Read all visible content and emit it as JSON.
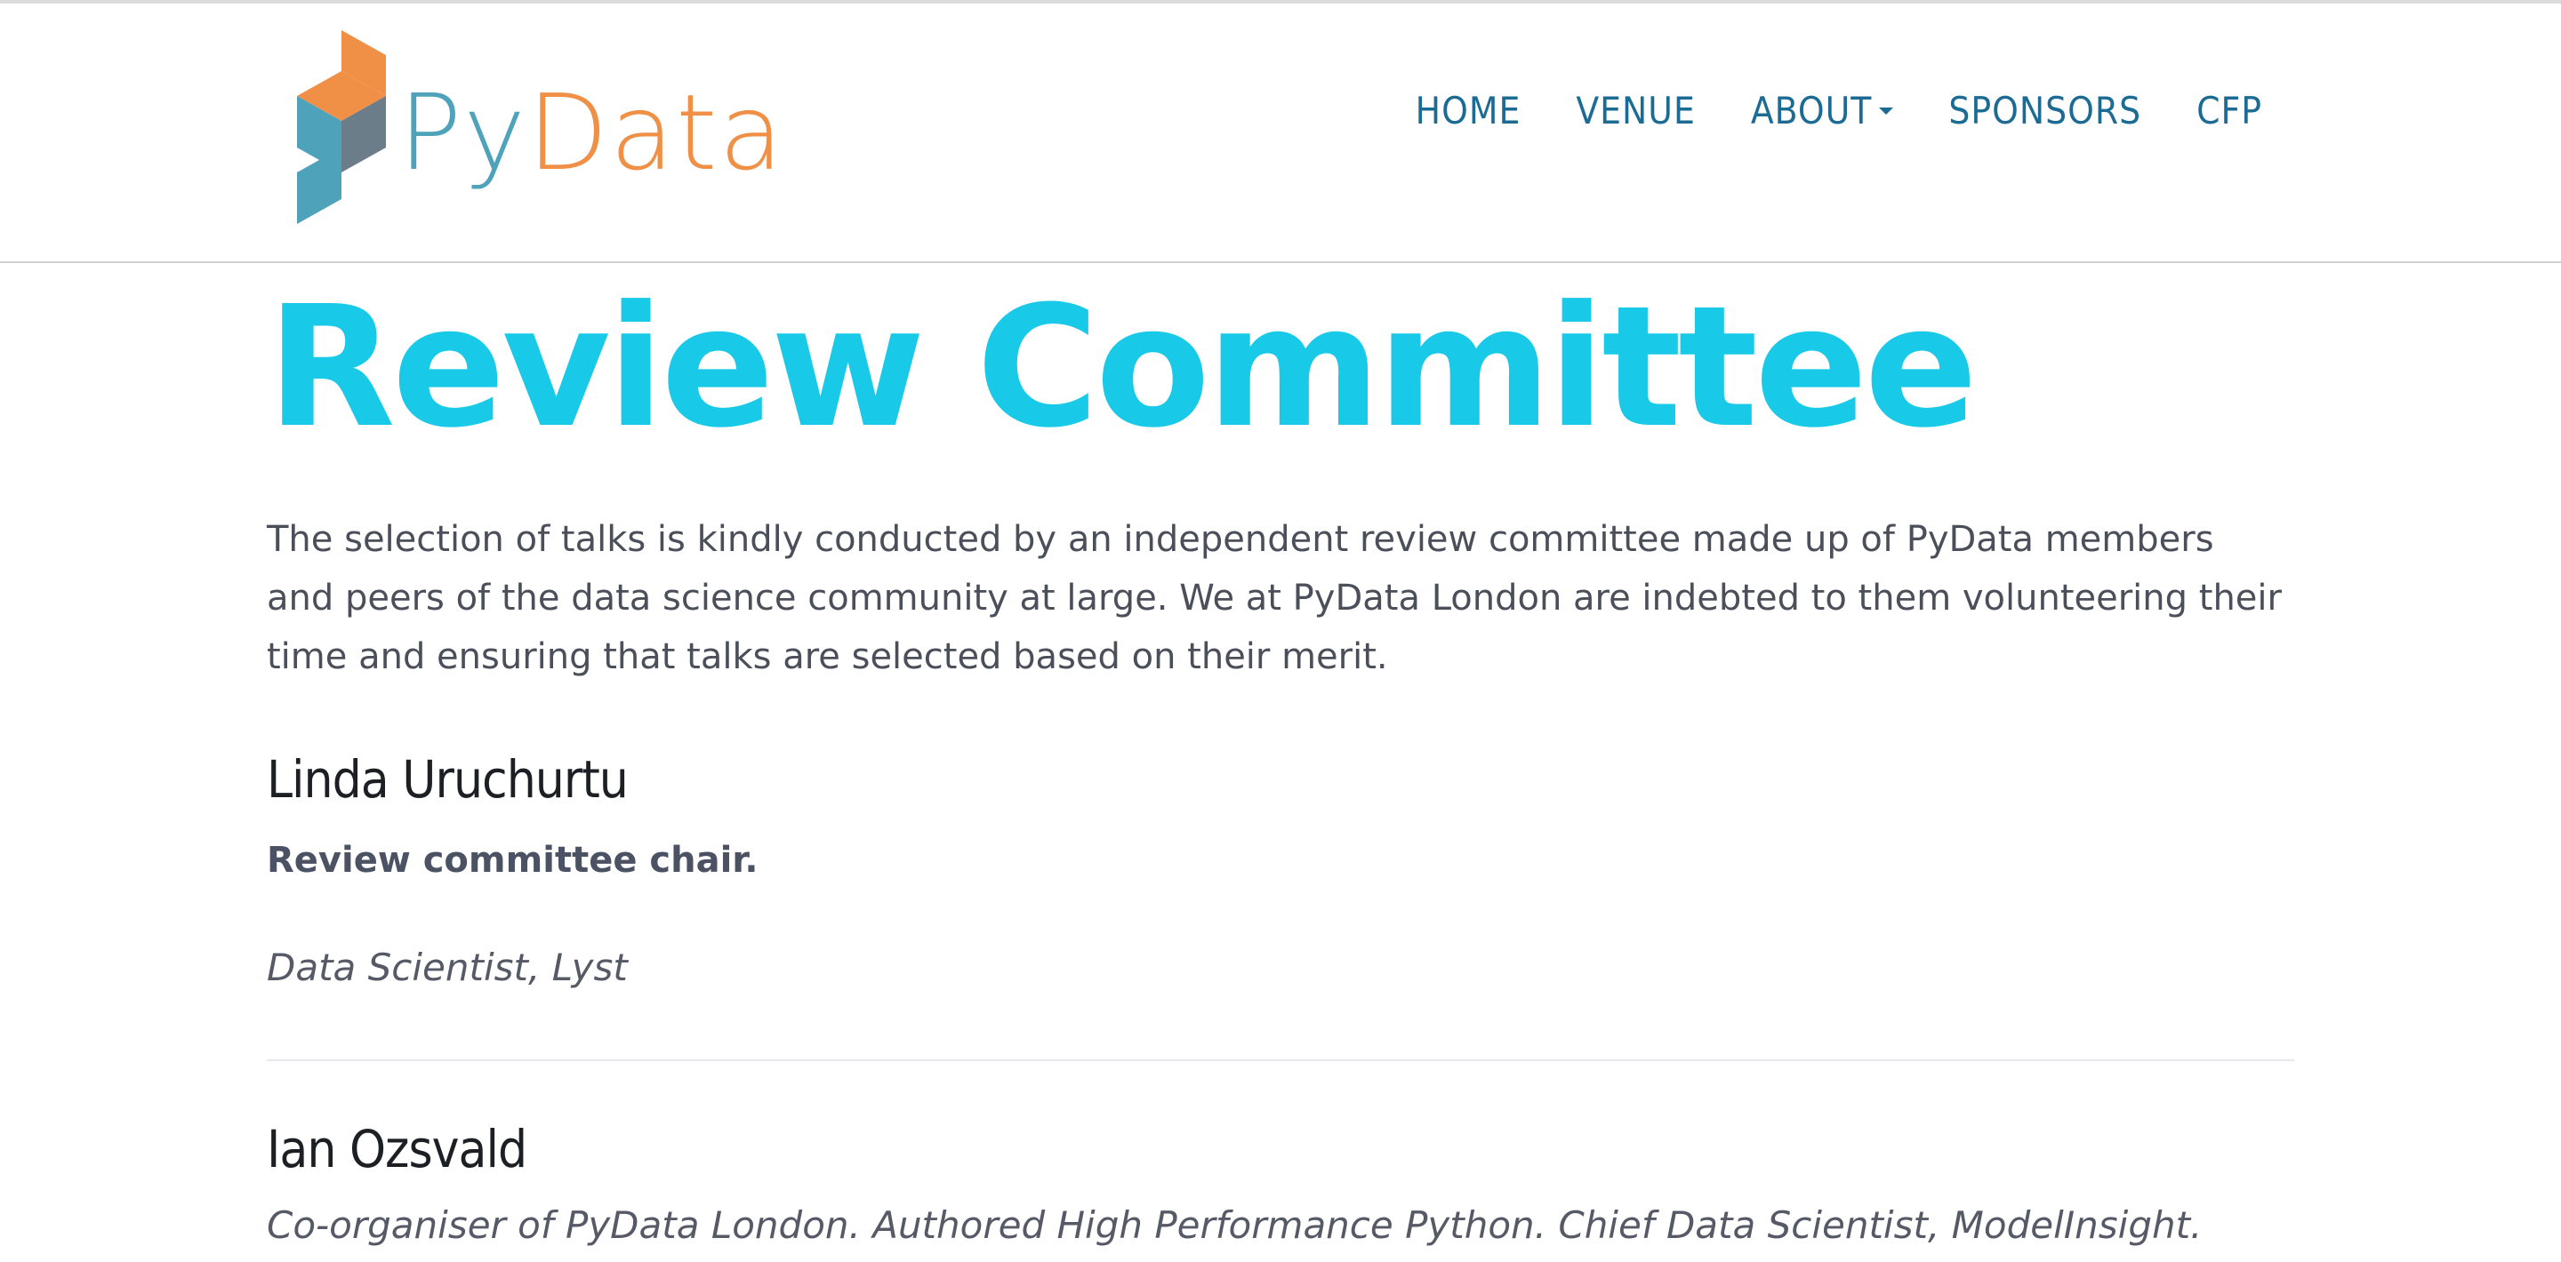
{
  "brand": {
    "logo_py": "Py",
    "logo_data": "Data",
    "colors": {
      "py": "#4ea3bb",
      "data": "#ef9046",
      "nav": "#1b6b94",
      "title": "#19c9e8"
    }
  },
  "nav": {
    "items": [
      {
        "label": "HOME"
      },
      {
        "label": "VENUE"
      },
      {
        "label": "ABOUT",
        "has_dropdown": true
      },
      {
        "label": "SPONSORS"
      },
      {
        "label": "CFP"
      }
    ]
  },
  "page": {
    "title": "Review Committee",
    "intro": "The selection of talks is kindly conducted by an independent review committee made up of PyData members and peers of the data science community at large. We at PyData London are indebted to them volunteering their time and ensuring that talks are selected based on their merit."
  },
  "members": [
    {
      "name": "Linda Uruchurtu",
      "role": "Review committee chair.",
      "affiliation": "Data Scientist, Lyst"
    },
    {
      "name": "Ian Ozsvald",
      "affiliation": "Co-organiser of PyData London. Authored High Performance Python. Chief Data Scientist, ModelInsight."
    }
  ]
}
